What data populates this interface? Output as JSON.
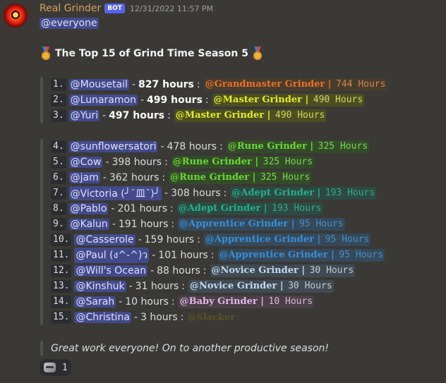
{
  "message": {
    "author": "Real Grinder",
    "bot_tag": "BOT",
    "timestamp": "12/31/2022 11:57 PM",
    "mention": "@everyone",
    "title": "The Top 15 of Grind Time Season 5",
    "closing": "Great work everyone! On to another productive season!"
  },
  "leaderboard_top": [
    {
      "num": "1.",
      "user": "@Mousetail",
      "hours": "827 hours",
      "sep": ":",
      "rank_name": "@Grandmaster Grinder",
      "rank_hours": "744 Hours",
      "rank_class": "r-gm",
      "bold": true
    },
    {
      "num": "2.",
      "user": "@Lunaramon",
      "hours": "499 hours",
      "sep": ":",
      "rank_name": "@Master Grinder",
      "rank_hours": "490 Hours",
      "rank_class": "r-master",
      "bold": true
    },
    {
      "num": "3.",
      "user": "@Yuri",
      "hours": "497 hours",
      "sep": ":",
      "rank_name": "@Master Grinder",
      "rank_hours": "490 Hours",
      "rank_class": "r-master",
      "bold": true
    }
  ],
  "leaderboard_rest": [
    {
      "num": "4.",
      "user": "@sunflowersatori",
      "hours": "478 hours",
      "sep": ":",
      "rank_name": "@Rune Grinder",
      "rank_hours": "325 Hours",
      "rank_class": "r-rune"
    },
    {
      "num": "5.",
      "user": "@Cow",
      "hours": "398 hours",
      "sep": ":",
      "rank_name": "@Rune Grinder",
      "rank_hours": "325 Hours",
      "rank_class": "r-rune"
    },
    {
      "num": "6.",
      "user": "@jam",
      "hours": "362 hours",
      "sep": ":",
      "rank_name": "@Rune Grinder",
      "rank_hours": "325 Hours",
      "rank_class": "r-rune"
    },
    {
      "num": "7.",
      "user": "@Victoria (╯¯皿¯)╯",
      "hours": "308 hours",
      "sep": ":",
      "rank_name": "@Adept Grinder",
      "rank_hours": "193 Hours",
      "rank_class": "r-adept"
    },
    {
      "num": "8.",
      "user": "@Pablo",
      "hours": "201 hours",
      "sep": ":",
      "rank_name": "@Adept Grinder",
      "rank_hours": "193 Hours",
      "rank_class": "r-adept"
    },
    {
      "num": "9.",
      "user": "@Kalun",
      "hours": "191 hours",
      "sep": ":",
      "rank_name": "@Apprentice Grinder",
      "rank_hours": "95 Hours",
      "rank_class": "r-appr"
    },
    {
      "num": "10.",
      "user": "@Casserole",
      "hours": "159 hours",
      "sep": ":",
      "rank_name": "@Apprentice Grinder",
      "rank_hours": "95 Hours",
      "rank_class": "r-appr"
    },
    {
      "num": "11.",
      "user": "@Paul (ง^-^)ว",
      "hours": "101 hours",
      "sep": ":",
      "rank_name": "@Apprentice Grinder",
      "rank_hours": "95 Hours",
      "rank_class": "r-appr"
    },
    {
      "num": "12.",
      "user": "@Will's Ocean",
      "hours": "88 hours",
      "sep": ":",
      "rank_name": "@Novice Grinder",
      "rank_hours": "30 Hours",
      "rank_class": "r-novice"
    },
    {
      "num": "13.",
      "user": "@Kinshuk",
      "hours": "31 hours",
      "sep": ":",
      "rank_name": "@Novice Grinder",
      "rank_hours": "30 Hours",
      "rank_class": "r-novice"
    },
    {
      "num": "14.",
      "user": "@Sarah",
      "hours": "10 hours",
      "sep": ":",
      "rank_name": "@Baby Grinder",
      "rank_hours": "10 Hours",
      "rank_class": "r-baby"
    },
    {
      "num": "15.",
      "user": "@Christina",
      "hours": "3 hours",
      "sep": ":",
      "rank_name": "@Slacker",
      "rank_hours": "",
      "rank_class": "r-slacker"
    }
  ],
  "reaction": {
    "icon": "cat-face-icon",
    "count": "1"
  }
}
